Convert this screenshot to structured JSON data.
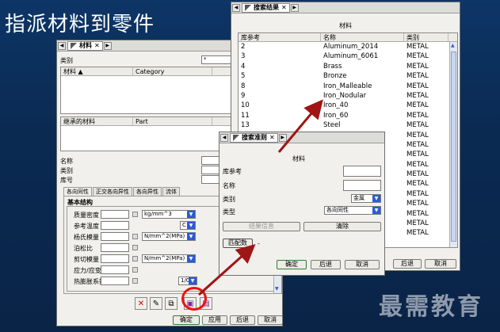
{
  "slide": {
    "title": "指派材料到零件",
    "watermark": "最需教育"
  },
  "materials_window": {
    "tab_label": "材料",
    "category_label": "类别",
    "category_value": "*",
    "list_headers": [
      "材料",
      "Category"
    ],
    "inherited_headers": [
      "继承的材料",
      "Part"
    ],
    "name_label": "名称",
    "type_label": "类别",
    "number_label": "库号",
    "tabs": [
      "各向同性",
      "正交各向异性",
      "各向异性",
      "流体"
    ],
    "section_label": "基本结构",
    "properties": [
      {
        "label": "质量密度",
        "unit": "kg/mm^3"
      },
      {
        "label": "参考温度",
        "unit": "C"
      },
      {
        "label": "杨氏模量",
        "unit": "N/mm^2(MPa)"
      },
      {
        "label": "泊松比",
        "unit": ""
      },
      {
        "label": "剪切模量",
        "unit": "N/mm^2(MPa)"
      },
      {
        "label": "应力/应变",
        "unit": ""
      },
      {
        "label": "热膨胀系数",
        "unit": "1/C"
      }
    ],
    "buttons": {
      "ok": "确定",
      "apply": "应用",
      "back": "后退",
      "cancel": "取消"
    }
  },
  "results_window": {
    "tab_label": "搜索结果",
    "title": "材料",
    "headers": [
      "库参考",
      "名称",
      "类别"
    ],
    "rows": [
      {
        "ref": "2",
        "name": "Aluminum_2014",
        "category": "METAL"
      },
      {
        "ref": "3",
        "name": "Aluminum_6061",
        "category": "METAL"
      },
      {
        "ref": "4",
        "name": "Brass",
        "category": "METAL"
      },
      {
        "ref": "5",
        "name": "Bronze",
        "category": "METAL"
      },
      {
        "ref": "8",
        "name": "Iron_Malleable",
        "category": "METAL"
      },
      {
        "ref": "9",
        "name": "Iron_Nodular",
        "category": "METAL"
      },
      {
        "ref": "10",
        "name": "Iron_40",
        "category": "METAL"
      },
      {
        "ref": "11",
        "name": "Iron_60",
        "category": "METAL"
      },
      {
        "ref": "13",
        "name": "Steel",
        "category": "METAL"
      },
      {
        "ref": "",
        "name": "",
        "category": "METAL"
      },
      {
        "ref": "",
        "name": "",
        "category": "METAL"
      },
      {
        "ref": "",
        "name": "",
        "category": "METAL"
      },
      {
        "ref": "",
        "name": "",
        "category": "METAL"
      },
      {
        "ref": "",
        "name": "",
        "category": "METAL"
      },
      {
        "ref": "",
        "name": "",
        "category": "METAL"
      },
      {
        "ref": "",
        "name": "",
        "category": "METAL"
      },
      {
        "ref": "",
        "name": "",
        "category": "METAL"
      },
      {
        "ref": "",
        "name": "",
        "category": "METAL"
      },
      {
        "ref": "",
        "name": "",
        "category": "METAL"
      },
      {
        "ref": "",
        "name": "",
        "category": "METAL"
      }
    ],
    "buttons": {
      "back": "后退",
      "cancel": "取消"
    }
  },
  "criteria_window": {
    "tab_label": "搜索准则",
    "title": "材料",
    "ref_label": "库参考",
    "name_label": "名称",
    "category_label": "类别",
    "category_value": "金属",
    "type_label": "类型",
    "type_value": "各向同性",
    "result_info": "结果信息",
    "clear": "清除",
    "match_count": "匹配数",
    "match_value": "-",
    "buttons": {
      "ok": "确定",
      "back": "后退",
      "cancel": "取消"
    }
  },
  "colors": {
    "accent_red": "#a01515",
    "highlight_circle": "#e11111",
    "dropdown_blue": "#2a5bd7"
  }
}
